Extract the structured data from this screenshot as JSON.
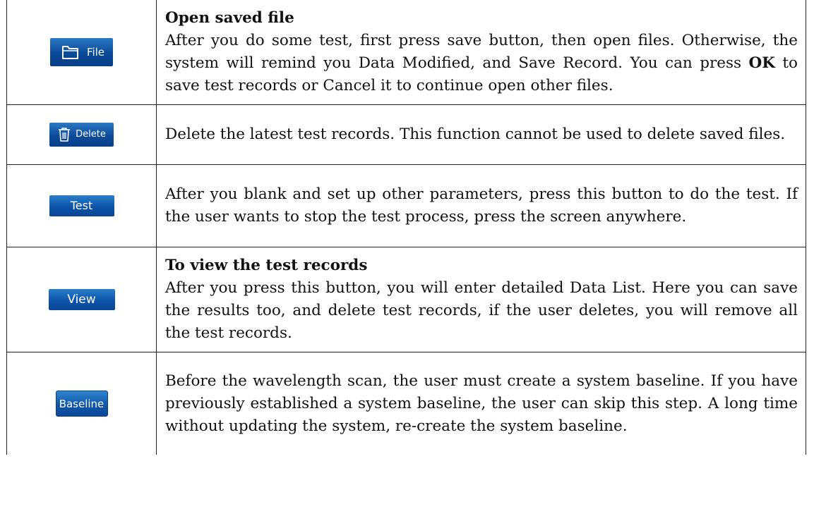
{
  "rows": [
    {
      "button": {
        "label": "File",
        "icon": "folder-icon"
      },
      "heading": "Open saved file",
      "desc_pre": "After you do some test, first press save button, then open files. Otherwise, the system will remind you Data Modified, and Save Record. You can press ",
      "desc_bold": "OK",
      "desc_post": " to save test records or Cancel it to continue open other files."
    },
    {
      "button": {
        "label": "Delete",
        "icon": "trash-icon"
      },
      "desc": "Delete the latest test records. This function cannot be used to delete saved files."
    },
    {
      "button": {
        "label": "Test"
      },
      "desc": "After you blank and set up other parameters, press this button to do the test. If the user wants to stop the test process, press the screen anywhere."
    },
    {
      "button": {
        "label": "View"
      },
      "heading": "To view the test records",
      "desc": "After you press this button, you will enter detailed Data List. Here you can save the results too, and delete test records, if the user deletes, you will remove all the test records."
    },
    {
      "button": {
        "label": "Baseline"
      },
      "desc": "Before the wavelength scan, the user must create a system baseline. If you have previously established a system baseline, the user can skip this step. A long time without updating the system, re-create the system baseline."
    }
  ],
  "colors": {
    "button_blue": "#0c53a8",
    "button_text": "#ffffff",
    "border": "#222222"
  }
}
